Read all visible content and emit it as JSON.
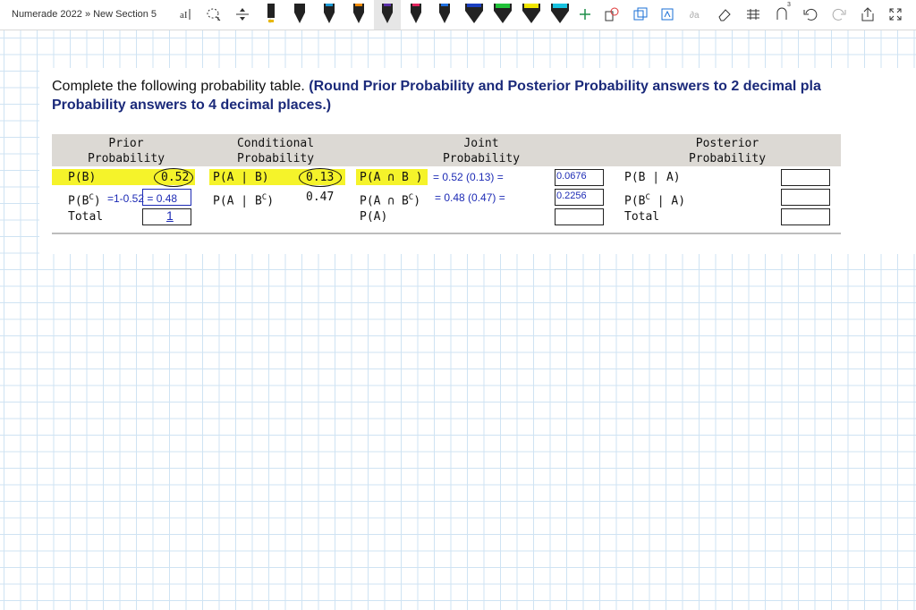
{
  "toolbar": {
    "breadcrumb": "Numerade 2022 » New Section 5",
    "icons": [
      "text-select-icon",
      "lasso-icon",
      "insert-space-icon",
      "pen-black-icon",
      "pen-black2-icon",
      "pen-teal-icon",
      "pen-orange-icon",
      "pen-purple-icon",
      "pen-red-icon",
      "pen-blue-icon",
      "highlighter-green-icon",
      "highlighter-yellow-icon",
      "highlighter-cyan-icon",
      "add-pen-icon",
      "ink-to-shape-icon",
      "ink-to-text-icon",
      "ink-to-math-icon",
      "eraser-icon",
      "ruler-icon",
      "replay-icon",
      "undo-icon",
      "redo-icon",
      "share-icon",
      "fullscreen-icon"
    ],
    "replay_badge": "3"
  },
  "question": {
    "text": "Complete the following probability table. ",
    "emphasis_line1": "(Round Prior Probability and Posterior Probability answers to 2 decimal pla",
    "emphasis_line2": "Probability answers to 4 decimal places.)"
  },
  "table": {
    "headers": {
      "prior_1": "Prior",
      "prior_2": "Probability",
      "cond_1": "Conditional",
      "cond_2": "Probability",
      "joint_1": "Joint",
      "joint_2": "Probability",
      "post_1": "Posterior",
      "post_2": "Probability"
    },
    "row1": {
      "prior_label": "P(B)",
      "prior_value": "0.52",
      "cond_label": "P(A | B)",
      "cond_value": "0.13",
      "joint_label": "P(A ∩ B )",
      "joint_work": "= 0.52 (0.13) =",
      "joint_answer": "0.0676",
      "post_label": "P(B | A)"
    },
    "row2": {
      "prior_label": "P(B",
      "prior_sup": "C",
      "prior_label_close": ")",
      "prior_work": "=1-0.52 = 0.48",
      "cond_label": "P(A | B",
      "cond_sup": "C",
      "cond_label_close": ")",
      "cond_value": "0.47",
      "joint_label": "P(A ∩ B",
      "joint_sup": "C",
      "joint_label_close": ")",
      "joint_work": "= 0.48 (0.47) =",
      "joint_answer": "0.2256",
      "post_label": "P(B",
      "post_sup": "C",
      "post_label_close": " | A)"
    },
    "row3": {
      "prior_label": "Total",
      "prior_answer": "1",
      "joint_label": "P(A)",
      "post_label": "Total"
    }
  },
  "colors": {
    "highlight": "#f5f32a",
    "ink": "#1d2bb5",
    "emphasis": "#1b2a7a",
    "grid": "#cfe3f3"
  }
}
